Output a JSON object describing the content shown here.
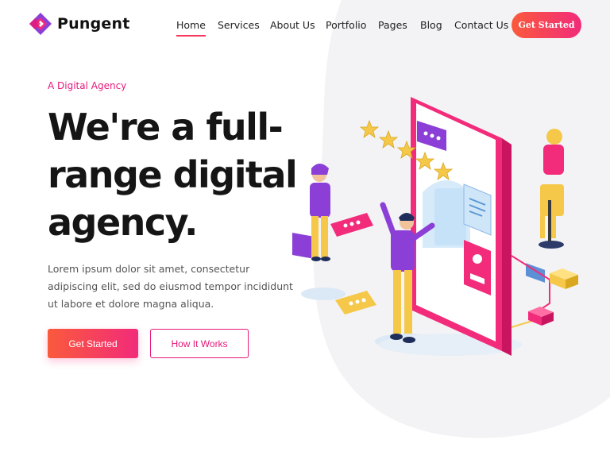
{
  "brand": {
    "name": "Pungent",
    "logo_icon": "diamond-logo-icon"
  },
  "nav": {
    "items": [
      {
        "label": "Home",
        "active": true
      },
      {
        "label": "Services",
        "active": false
      },
      {
        "label": "About Us",
        "active": false
      },
      {
        "label": "Portfolio",
        "active": false
      },
      {
        "label": "Pages",
        "active": false
      },
      {
        "label": "Blog",
        "active": false
      },
      {
        "label": "Contact Us",
        "active": false
      }
    ],
    "cta_label": "Get Started"
  },
  "hero": {
    "kicker": "A Digital Agency",
    "headline": "We're a full-range digital agency.",
    "lede": "Lorem ipsum dolor sit amet, consectetur adipiscing elit, sed do eiusmod tempor incididunt ut labore et dolore magna aliqua.",
    "primary_button": "Get Started",
    "secondary_button": "How It Works"
  },
  "colors": {
    "accent": "#e6197a",
    "gradient_start": "#fa5a3c",
    "gradient_end": "#f22b7a",
    "purple": "#8b3fd6",
    "yellow": "#f5c84a"
  }
}
